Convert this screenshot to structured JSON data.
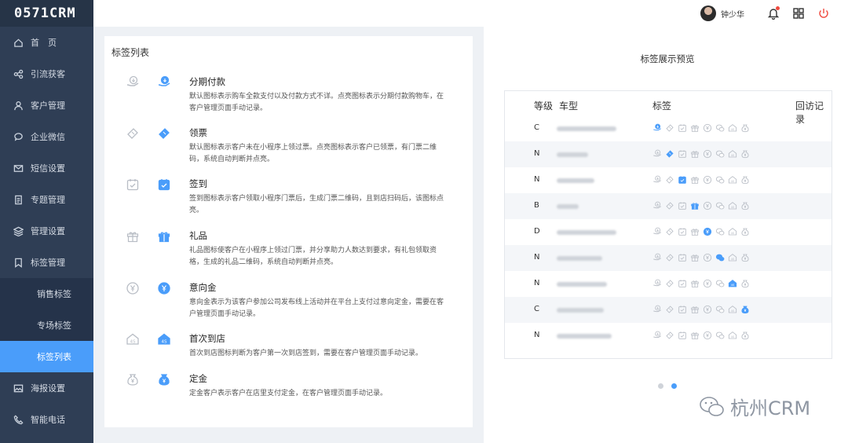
{
  "app": {
    "logo": "0571CRM"
  },
  "sidebar": {
    "items": [
      {
        "label": "首　页",
        "icon": "home-icon"
      },
      {
        "label": "引流获客",
        "icon": "share-icon"
      },
      {
        "label": "客户管理",
        "icon": "user-icon"
      },
      {
        "label": "企业微信",
        "icon": "chat-icon"
      },
      {
        "label": "短信设置",
        "icon": "mail-icon"
      },
      {
        "label": "专题管理",
        "icon": "document-icon"
      },
      {
        "label": "管理设置",
        "icon": "layers-icon"
      },
      {
        "label": "标签管理",
        "icon": "bookmark-icon"
      }
    ],
    "submenu": [
      {
        "label": "销售标签",
        "active": false
      },
      {
        "label": "专场标签",
        "active": false
      },
      {
        "label": "标签列表",
        "active": true
      }
    ],
    "items_after": [
      {
        "label": "海报设置",
        "icon": "image-icon"
      },
      {
        "label": "智能电话",
        "icon": "phone-icon"
      }
    ]
  },
  "topbar": {
    "username": "钟少华"
  },
  "tag_list": {
    "title": "标签列表",
    "tags": [
      {
        "name": "分期付款",
        "desc": "默认图标表示购车全款支付以及付款方式不详。点亮图标表示分期付款购物车，在客户管理页面手动记录。",
        "icon": "installment-icon"
      },
      {
        "name": "领票",
        "desc": "默认图标表示客户未在小程序上领过票。点亮图标表示客户已领票，有门票二维码，系统自动判断并点亮。",
        "icon": "ticket-icon"
      },
      {
        "name": "签到",
        "desc": "签到图标表示客户领取小程序门票后，生成门票二维码，且到店扫码后，该图标点亮。",
        "icon": "checkin-icon"
      },
      {
        "name": "礼品",
        "desc": "礼品图标使客户在小程序上领过门票，并分享助力人数达到要求，有礼包领取资格，生成的礼品二维码，系统自动判断并点亮。",
        "icon": "gift-icon"
      },
      {
        "name": "意向金",
        "desc": "意向金表示为该客户参加公司发布线上活动并在平台上支付过意向定金，需要在客户管理页面手动记录。",
        "icon": "yen-icon"
      },
      {
        "name": "首次到店",
        "desc": "首次到店图标判断为客户第一次到店签到，需要在客户管理页面手动记录。",
        "icon": "store-icon"
      },
      {
        "name": "定金",
        "desc": "定金客户表示客户在店里支付定金，在客户管理页面手动记录。",
        "icon": "moneybag-icon"
      }
    ]
  },
  "preview": {
    "title": "标签展示预览",
    "columns": {
      "level": "等级",
      "model": "车型",
      "tags": "标签",
      "visit": "回访记录"
    },
    "rows": [
      {
        "level": "C",
        "active": 0
      },
      {
        "level": "N",
        "active": 1
      },
      {
        "level": "N",
        "active": 2
      },
      {
        "level": "B",
        "active": 3
      },
      {
        "level": "D",
        "active": 4
      },
      {
        "level": "N",
        "active": 5
      },
      {
        "level": "N",
        "active": 6
      },
      {
        "level": "C",
        "active": 7
      },
      {
        "level": "N",
        "active": -1
      }
    ],
    "pager": {
      "total": 2,
      "current": 2
    }
  },
  "watermark": {
    "text": "杭州CRM"
  },
  "colors": {
    "accent": "#4a9dfa",
    "sidebar": "#2f3e55",
    "icon_off": "#b8bdc5",
    "danger": "#f0493e"
  }
}
